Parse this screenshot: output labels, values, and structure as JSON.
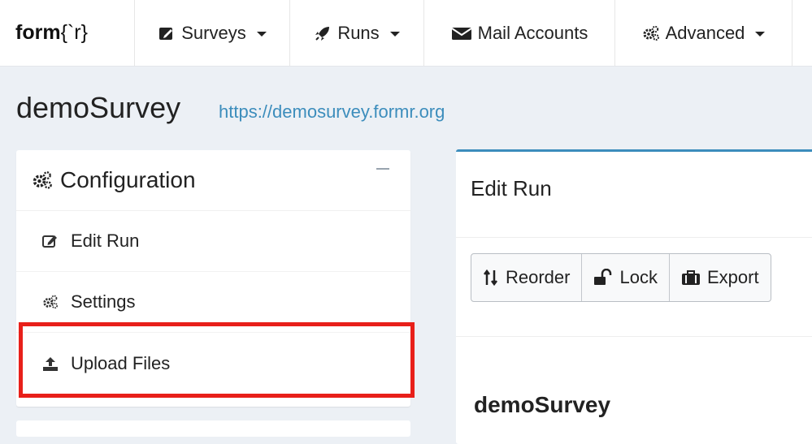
{
  "navbar": {
    "brand_bold": "form",
    "brand_rest": "{`r}",
    "items": [
      {
        "label": "Surveys",
        "icon": "edit-icon",
        "dropdown": true
      },
      {
        "label": "Runs",
        "icon": "rocket-icon",
        "dropdown": true
      },
      {
        "label": "Mail Accounts",
        "icon": "envelope-icon",
        "dropdown": false
      },
      {
        "label": "Advanced",
        "icon": "cogs-icon",
        "dropdown": true
      }
    ]
  },
  "page": {
    "title": "demoSurvey",
    "url": "https://demosurvey.formr.org"
  },
  "config": {
    "header": "Configuration",
    "items": [
      {
        "label": "Edit Run",
        "icon": "edit-icon"
      },
      {
        "label": "Settings",
        "icon": "cogs-icon"
      },
      {
        "label": "Upload Files",
        "icon": "upload-icon"
      }
    ]
  },
  "run_panel": {
    "title": "Edit Run",
    "buttons": [
      {
        "label": "Reorder",
        "icon": "sort-icon"
      },
      {
        "label": "Lock",
        "icon": "unlock-icon"
      },
      {
        "label": "Export",
        "icon": "briefcase-icon"
      }
    ],
    "run_name": "demoSurvey"
  },
  "colors": {
    "accent": "#3c8dbc",
    "highlight": "#e8201a",
    "background": "#ecf0f5"
  }
}
